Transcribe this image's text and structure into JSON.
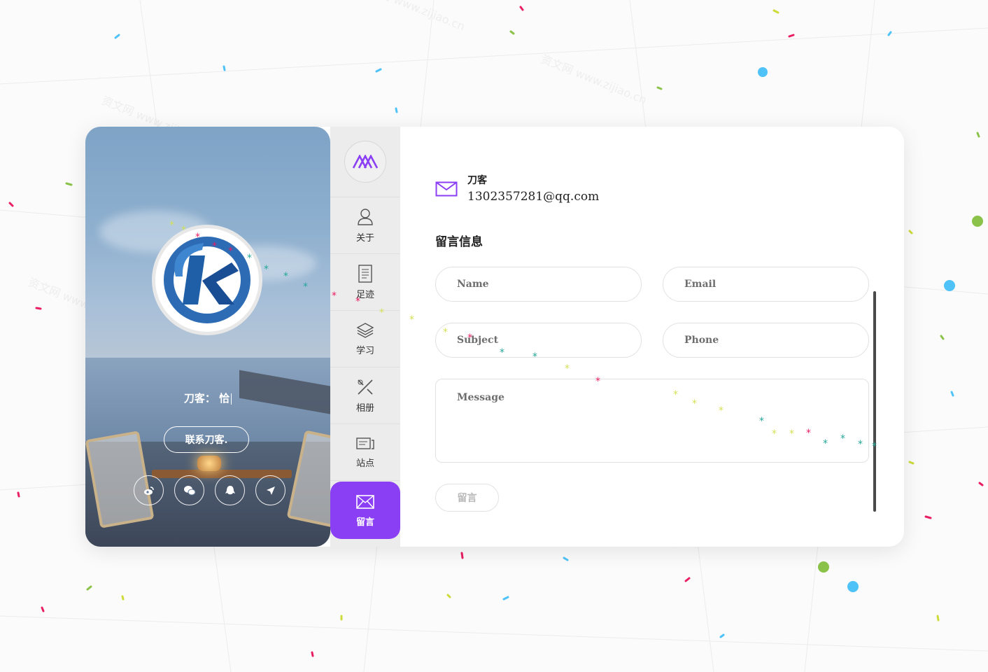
{
  "profile": {
    "tagline": "刀客：  恰",
    "contact_label": "联系刀客.",
    "socials": [
      {
        "icon": "weibo-icon"
      },
      {
        "icon": "wechat-icon"
      },
      {
        "icon": "qq-icon"
      },
      {
        "icon": "location-arrow-icon"
      }
    ]
  },
  "nav": {
    "items": [
      {
        "label": "关于",
        "icon": "user-icon"
      },
      {
        "label": "足迹",
        "icon": "document-icon"
      },
      {
        "label": "学习",
        "icon": "layers-icon"
      },
      {
        "label": "相册",
        "icon": "tools-icon"
      },
      {
        "label": "站点",
        "icon": "site-icon"
      },
      {
        "label": "留言",
        "icon": "mail-icon",
        "active": true
      }
    ]
  },
  "contact": {
    "name": "刀客",
    "email": "1302357281@qq.com"
  },
  "form": {
    "title": "留言信息",
    "name_placeholder": "Name",
    "email_placeholder": "Email",
    "subject_placeholder": "Subject",
    "phone_placeholder": "Phone",
    "message_placeholder": "Message",
    "submit_label": "留言"
  },
  "watermark": {
    "text": "资文网 www.zijiao.cn"
  },
  "colors": {
    "accent": "#8b3ff5",
    "logo_blue": "#1f5fa8"
  }
}
